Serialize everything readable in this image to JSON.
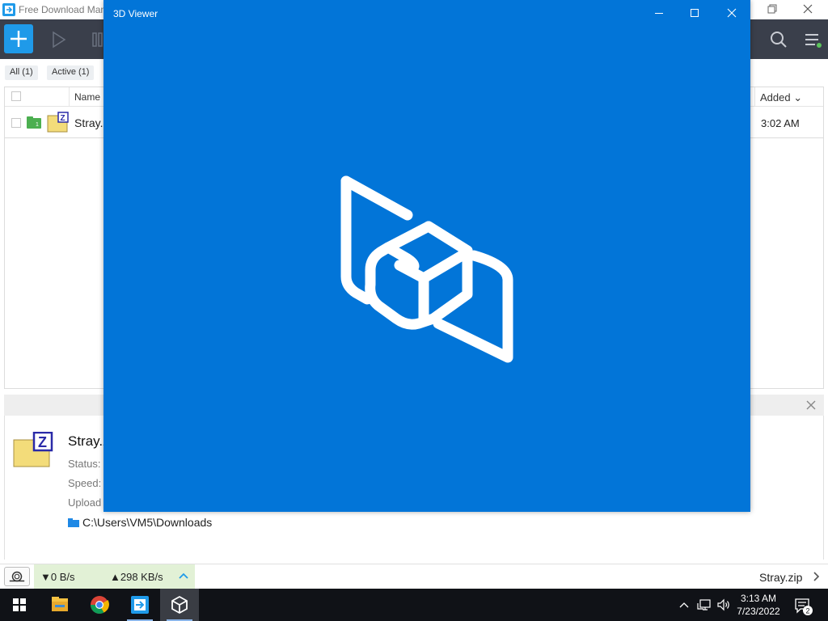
{
  "fdm": {
    "title": "Free Download Manager",
    "filters": [
      "All (1)",
      "Active (1)"
    ],
    "columns": {
      "name": "Name",
      "added": "Added ⌄"
    },
    "rows": [
      {
        "name": "Stray.zip",
        "added": "3:02 AM"
      }
    ],
    "details": {
      "name": "Stray.zip",
      "status_label": "Status:",
      "speed_label": "Speed:",
      "upload_label": "Upload",
      "path": "C:\\Users\\VM5\\Downloads"
    },
    "statusbar": {
      "download_speed": "▼0 B/s",
      "upload_speed": "▲298 KB/s",
      "file": "Stray.zip"
    }
  },
  "viewer": {
    "title": "3D Viewer",
    "background": "#0275d8"
  },
  "taskbar": {
    "apps": [
      "start-icon",
      "file-explorer-icon",
      "chrome-icon",
      "fdm-icon",
      "3d-viewer-icon"
    ],
    "time": "3:13 AM",
    "date": "7/23/2022",
    "notifications": "2"
  },
  "colors": {
    "fdm_toolbar": "#3a3f4b",
    "fdm_accent": "#1f9ae9",
    "speed_bg": "#e2f1d6",
    "taskbar": "#101217"
  }
}
